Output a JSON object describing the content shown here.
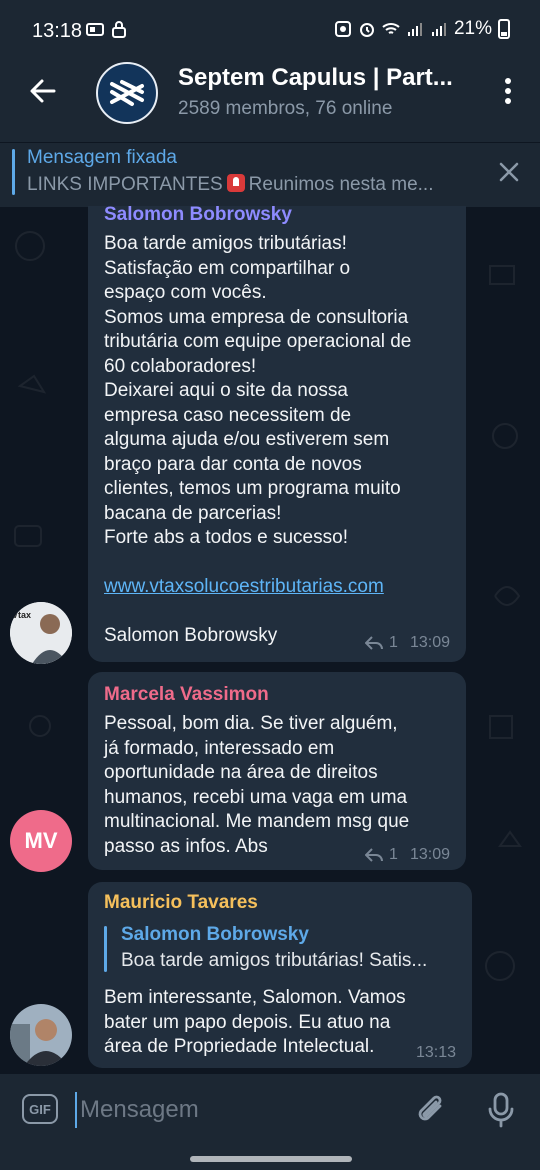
{
  "status_bar": {
    "time": "13:18",
    "battery": "21%"
  },
  "header": {
    "title": "Septem Capulus | Part...",
    "subtitle": "2589 membros, 76 online"
  },
  "pinned": {
    "label": "Mensagem fixada",
    "text_before": "LINKS IMPORTANTES",
    "text_after": "Reunimos nesta me..."
  },
  "messages": [
    {
      "sender": "Salomon Bobrowsky",
      "sender_color": "#8e8bff",
      "body": "Boa tarde amigos tributárias!\nSatisfação em compartilhar o\nespaço com vocês.\nSomos uma empresa de consultoria\ntributária com equipe operacional de\n60 colaboradores!\nDeixarei aqui o site da nossa\nempresa caso necessitem de\nalguma ajuda e/ou estiverem sem\nbraço para dar conta de novos\nclientes, temos um programa muito\nbacana de parcerias!\nForte abs a todos e sucesso!",
      "link": "www.vtaxsolucoestributarias.com",
      "signature": "Salomon Bobrowsky",
      "replies": "1",
      "time": "13:09"
    },
    {
      "sender": "Marcela Vassimon",
      "sender_color": "#ef6b8a",
      "avatar_initials": "MV",
      "body": "Pessoal, bom dia. Se tiver alguém,\njá formado, interessado em\noportunidade na área de direitos\nhumanos, recebi uma vaga em uma\nmultinacional. Me mandem msg que\npasso as infos. Abs",
      "replies": "1",
      "time": "13:09"
    },
    {
      "sender": "Mauricio Tavares",
      "sender_color": "#f5c05c",
      "quote_name": "Salomon Bobrowsky",
      "quote_text": "Boa tarde amigos tributárias! Satis...",
      "body": "Bem interessante, Salomon. Vamos\nbater um papo depois. Eu atuo na\nárea de Propriedade Intelectual.",
      "time": "13:13"
    }
  ],
  "composer": {
    "gif_label": "GIF",
    "placeholder": "Mensagem"
  },
  "colors": {
    "background": "#0e1621",
    "bar": "#1c2733",
    "bubble": "#212e3d",
    "accent": "#5ea9e8",
    "link": "#5eb5f7"
  }
}
